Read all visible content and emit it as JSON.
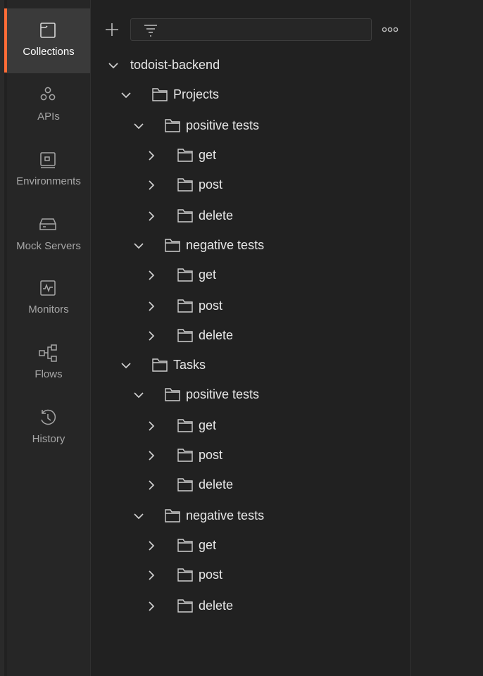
{
  "sidebar": {
    "items": [
      {
        "label": "Collections",
        "icon": "collections-icon",
        "active": true
      },
      {
        "label": "APIs",
        "icon": "apis-icon",
        "active": false
      },
      {
        "label": "Environments",
        "icon": "environments-icon",
        "active": false
      },
      {
        "label": "Mock Servers",
        "icon": "mock-servers-icon",
        "active": false
      },
      {
        "label": "Monitors",
        "icon": "monitors-icon",
        "active": false
      },
      {
        "label": "Flows",
        "icon": "flows-icon",
        "active": false
      },
      {
        "label": "History",
        "icon": "history-icon",
        "active": false
      }
    ]
  },
  "toolbar": {
    "add_icon": "plus-icon",
    "filter_icon": "filter-icon",
    "filter_value": "",
    "more_icon": "more-options-icon"
  },
  "tree": [
    {
      "label": "todoist-backend",
      "level": 0,
      "expanded": true,
      "folder": false
    },
    {
      "label": "Projects",
      "level": 1,
      "expanded": true,
      "folder": true
    },
    {
      "label": "positive tests",
      "level": 2,
      "expanded": true,
      "folder": true
    },
    {
      "label": "get",
      "level": 3,
      "expanded": false,
      "folder": true
    },
    {
      "label": "post",
      "level": 3,
      "expanded": false,
      "folder": true
    },
    {
      "label": "delete",
      "level": 3,
      "expanded": false,
      "folder": true
    },
    {
      "label": "negative tests",
      "level": 2,
      "expanded": true,
      "folder": true
    },
    {
      "label": "get",
      "level": 3,
      "expanded": false,
      "folder": true
    },
    {
      "label": "post",
      "level": 3,
      "expanded": false,
      "folder": true
    },
    {
      "label": "delete",
      "level": 3,
      "expanded": false,
      "folder": true
    },
    {
      "label": "Tasks",
      "level": 1,
      "expanded": true,
      "folder": true
    },
    {
      "label": "positive tests",
      "level": 2,
      "expanded": true,
      "folder": true
    },
    {
      "label": "get",
      "level": 3,
      "expanded": false,
      "folder": true
    },
    {
      "label": "post",
      "level": 3,
      "expanded": false,
      "folder": true
    },
    {
      "label": "delete",
      "level": 3,
      "expanded": false,
      "folder": true
    },
    {
      "label": "negative tests",
      "level": 2,
      "expanded": true,
      "folder": true
    },
    {
      "label": "get",
      "level": 3,
      "expanded": false,
      "folder": true
    },
    {
      "label": "post",
      "level": 3,
      "expanded": false,
      "folder": true
    },
    {
      "label": "delete",
      "level": 3,
      "expanded": false,
      "folder": true
    }
  ],
  "colors": {
    "accent": "#ff6c37",
    "sidebar_bg": "#262626",
    "active_bg": "#3a3a3a",
    "panel_bg": "#212121"
  }
}
